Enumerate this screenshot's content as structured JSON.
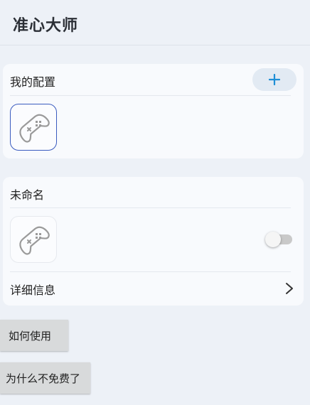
{
  "app": {
    "title": "准心大师"
  },
  "my_config": {
    "title": "我的配置",
    "add_label": "+",
    "accent_color": "#1e8fd6"
  },
  "preset": {
    "name": "未命名",
    "toggle_on": false,
    "detail_label": "详细信息"
  },
  "buttons": {
    "how_to_use": "如何使用",
    "why_not_free": "为什么不免费了"
  },
  "icons": [
    "gamepad-icon",
    "plus-icon",
    "chevron-right-icon"
  ]
}
